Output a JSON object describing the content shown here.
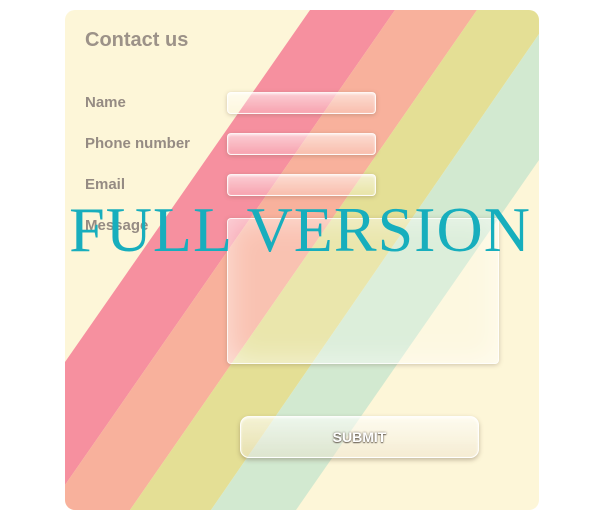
{
  "form": {
    "title": "Contact us",
    "fields": [
      {
        "label": "Name",
        "value": ""
      },
      {
        "label": "Phone number",
        "value": ""
      },
      {
        "label": "Email",
        "value": ""
      },
      {
        "label": "Message",
        "value": ""
      }
    ],
    "submit_label": "SUBMIT"
  },
  "watermark": "FULL VERSION",
  "colors": {
    "background": "#fdf6d8",
    "stripe_pink": "#f6909f",
    "stripe_salmon": "#f8b19c",
    "stripe_yellow": "#e4df95",
    "stripe_mint": "#d2e9d0",
    "label_text": "#958b83",
    "watermark_text": "#17aebd"
  }
}
